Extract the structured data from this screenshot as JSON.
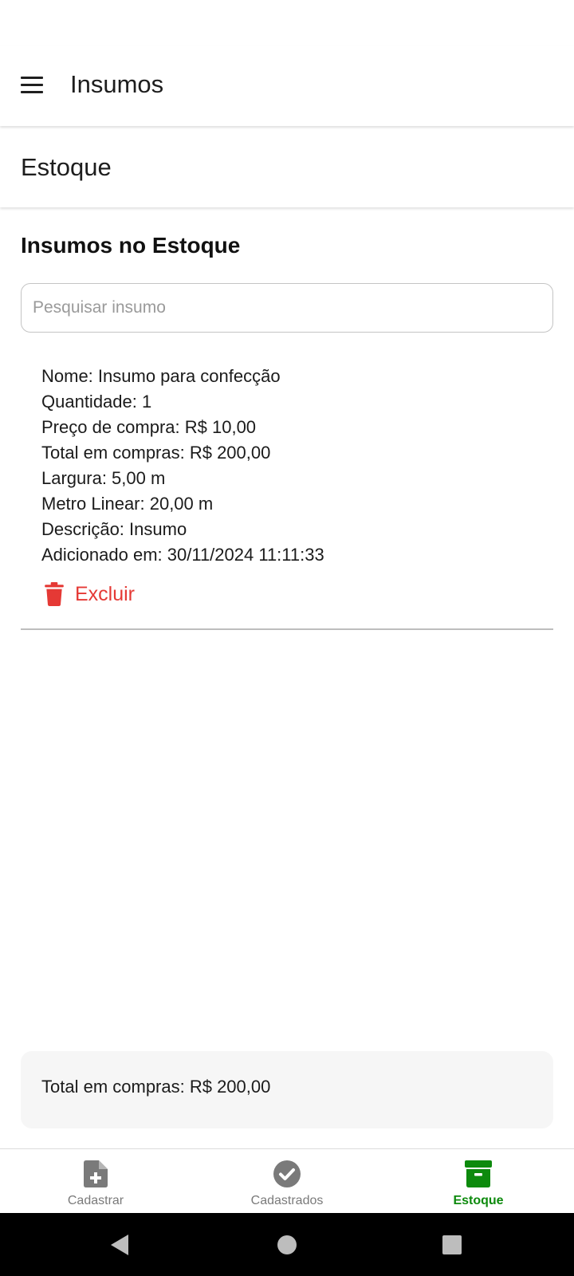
{
  "app_bar": {
    "title": "Insumos",
    "menu_icon": "hamburger-menu-icon"
  },
  "page": {
    "title": "Estoque"
  },
  "section": {
    "title": "Insumos no Estoque"
  },
  "search": {
    "placeholder": "Pesquisar insumo",
    "value": ""
  },
  "items": [
    {
      "nome": "Nome: Insumo para confecção",
      "quantidade": "Quantidade: 1",
      "preco_compra": "Preço de compra: R$ 10,00",
      "total_compras": "Total em compras: R$ 200,00",
      "largura": "Largura: 5,00 m",
      "metro_linear": "Metro Linear: 20,00 m",
      "descricao": "Descrição: Insumo",
      "adicionado_em": "Adicionado em: 30/11/2024 11:11:33",
      "delete_label": "Excluir",
      "delete_icon": "trash-icon"
    }
  ],
  "summary": {
    "total_text": "Total em compras: R$ 200,00"
  },
  "bottom_nav": {
    "items": [
      {
        "label": "Cadastrar",
        "icon": "file-plus-icon",
        "active": false
      },
      {
        "label": "Cadastrados",
        "icon": "check-circle-icon",
        "active": false
      },
      {
        "label": "Estoque",
        "icon": "archive-box-icon",
        "active": true
      }
    ]
  },
  "colors": {
    "accent_active": "#0d8a0d",
    "danger": "#e53935",
    "inactive_icon": "#7a7a7a"
  }
}
